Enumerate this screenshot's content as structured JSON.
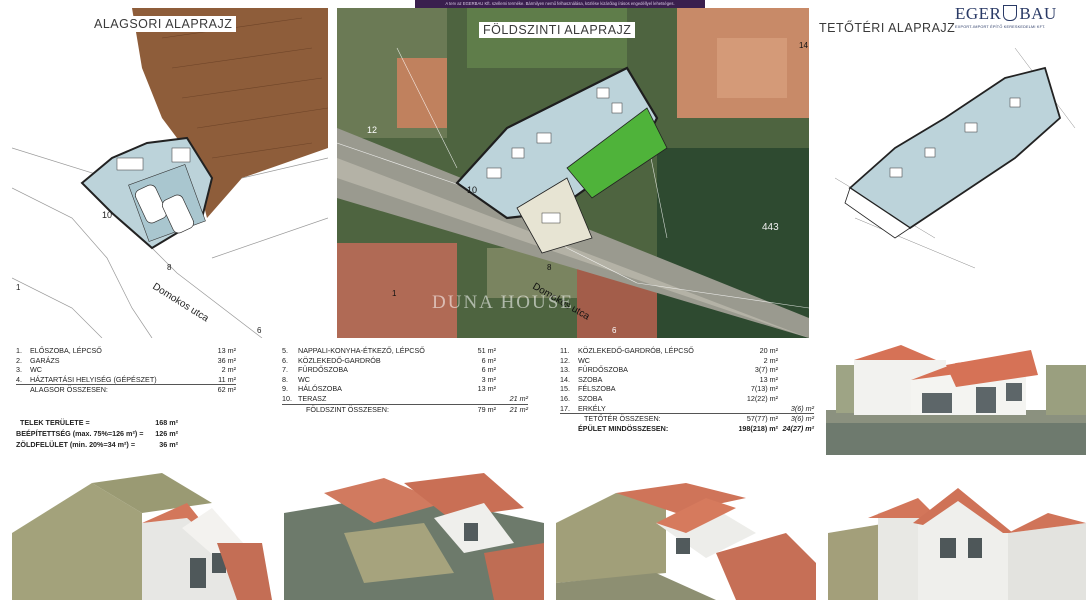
{
  "banner": {
    "text": "A terv az EGERBAU Kft. szellemi terméke. Bármilyen nemű felhasználása, közlése kizárólag írásos engedéllyel lehetséges."
  },
  "logo": {
    "brand_left": "EGER",
    "brand_right": "BAU",
    "tagline": "EXPORT-IMPORT ÉPÍTŐ KERESKEDELMI KFT."
  },
  "plans": {
    "basement": {
      "title": "ALAGSORI  ALAPRAJZ",
      "street": "Domokos utca",
      "lot_10": "10",
      "lot_8": "8",
      "lot_6": "6",
      "lot_1": "1"
    },
    "ground": {
      "title": "FÖLDSZINTI  ALAPRAJZ",
      "street": "Domokos utca",
      "lot_12": "12",
      "lot_10": "10",
      "lot_8": "8",
      "lot_6": "6",
      "lot_1": "1",
      "lot_443": "443",
      "lot_14": "14",
      "watermark": "DUNA HOUSE"
    },
    "attic": {
      "title": "TETŐTÉRI  ALAPRAJZ"
    }
  },
  "tables": {
    "basement_rooms": [
      {
        "num": "1.",
        "name": "ELŐSZOBA, LÉPCSŐ",
        "area": "13 m²"
      },
      {
        "num": "2.",
        "name": "GARÁZS",
        "area": "36 m²"
      },
      {
        "num": "3.",
        "name": "WC",
        "area": "2 m²"
      },
      {
        "num": "4.",
        "name": "HÁZTARTÁSI HELYISÉG (GÉPÉSZET)",
        "area": "11 m²"
      }
    ],
    "basement_total": {
      "name": "ALAGSOR ÖSSZESEN:",
      "area": "62 m²"
    },
    "ground_rooms": [
      {
        "num": "5.",
        "name": "NAPPALI-KONYHA-ÉTKEZŐ, LÉPCSŐ",
        "area": "51 m²",
        "extra": ""
      },
      {
        "num": "6.",
        "name": "KÖZLEKEDŐ-GARDRÓB",
        "area": "6 m²",
        "extra": ""
      },
      {
        "num": "7.",
        "name": "FÜRDŐSZOBA",
        "area": "6 m²",
        "extra": ""
      },
      {
        "num": "8.",
        "name": "WC",
        "area": "3 m²",
        "extra": ""
      },
      {
        "num": "9.",
        "name": "HÁLÓSZOBA",
        "area": "13 m²",
        "extra": ""
      },
      {
        "num": "10.",
        "name": "TERASZ",
        "area": "",
        "extra": "21 m²"
      }
    ],
    "ground_total": {
      "name": "FÖLDSZINT ÖSSZESEN:",
      "area": "79 m²",
      "extra": "21 m²"
    },
    "attic_rooms": [
      {
        "num": "11.",
        "name": "KÖZLEKEDŐ-GARDRÓB, LÉPCSŐ",
        "area": "20 m²",
        "extra": ""
      },
      {
        "num": "12.",
        "name": "WC",
        "area": "2 m²",
        "extra": ""
      },
      {
        "num": "13.",
        "name": "FÜRDŐSZOBA",
        "area": "3(7) m²",
        "extra": ""
      },
      {
        "num": "14.",
        "name": "SZOBA",
        "area": "13 m²",
        "extra": ""
      },
      {
        "num": "15.",
        "name": "FÉLSZOBA",
        "area": "7(13) m²",
        "extra": ""
      },
      {
        "num": "16.",
        "name": "SZOBA",
        "area": "12(22) m²",
        "extra": ""
      },
      {
        "num": "17.",
        "name": "ERKÉLY",
        "area": "",
        "extra": "3(6) m²"
      }
    ],
    "attic_total": {
      "name": "TETŐTÉR ÖSSZESEN:",
      "area": "57(77) m²",
      "extra": "3(6) m²"
    },
    "grand_total": {
      "name": "ÉPÜLET MINDÖSSZESEN:",
      "area": "198(218) m²",
      "extra": "24(27) m²"
    }
  },
  "stats": [
    {
      "label": "TELEK TERÜLETE =",
      "value": "168 m²"
    },
    {
      "label": "BEÉPÍTETTSÉG (max. 75%=126 m²) =",
      "value": "126 m²"
    },
    {
      "label": "ZÖLDFELÜLET (min. 20%=34 m²) =",
      "value": "36 m²"
    }
  ]
}
